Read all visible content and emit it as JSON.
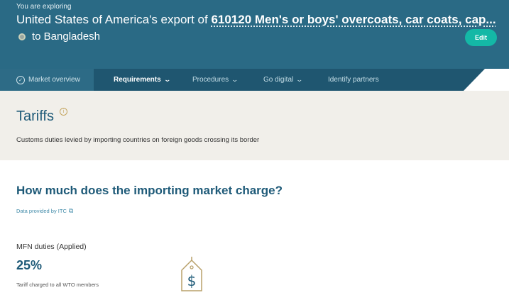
{
  "header": {
    "exploring_label": "You are exploring",
    "title_prefix": "United States of America's export of ",
    "product": "610120 Men's or boys' overcoats, car coats, cap...",
    "destination": "to Bangladesh",
    "edit_label": "Edit"
  },
  "nav": {
    "items": [
      {
        "label": "Market overview",
        "icon": "check-circle-icon"
      },
      {
        "label": "Requirements",
        "icon": "chevron-down-icon",
        "active": true
      },
      {
        "label": "Procedures",
        "icon": "chevron-down-icon"
      },
      {
        "label": "Go digital",
        "icon": "chevron-down-icon"
      },
      {
        "label": "Identify partners"
      }
    ]
  },
  "tariffs": {
    "title": "Tariffs",
    "description": "Customs duties levied by importing countries on foreign goods crossing its border"
  },
  "market_charge": {
    "question": "How much does the importing market charge?",
    "provided_by": "Data provided by ITC",
    "mfn_label": "MFN duties (Applied)",
    "mfn_value": "25%",
    "mfn_note": "Tariff charged to all WTO members"
  },
  "colors": {
    "header_bg": "#2a6a85",
    "nav_bg": "#1f5670",
    "accent": "#14b8a6",
    "band_bg": "#f1efea",
    "tag_color": "#b8a06a"
  }
}
